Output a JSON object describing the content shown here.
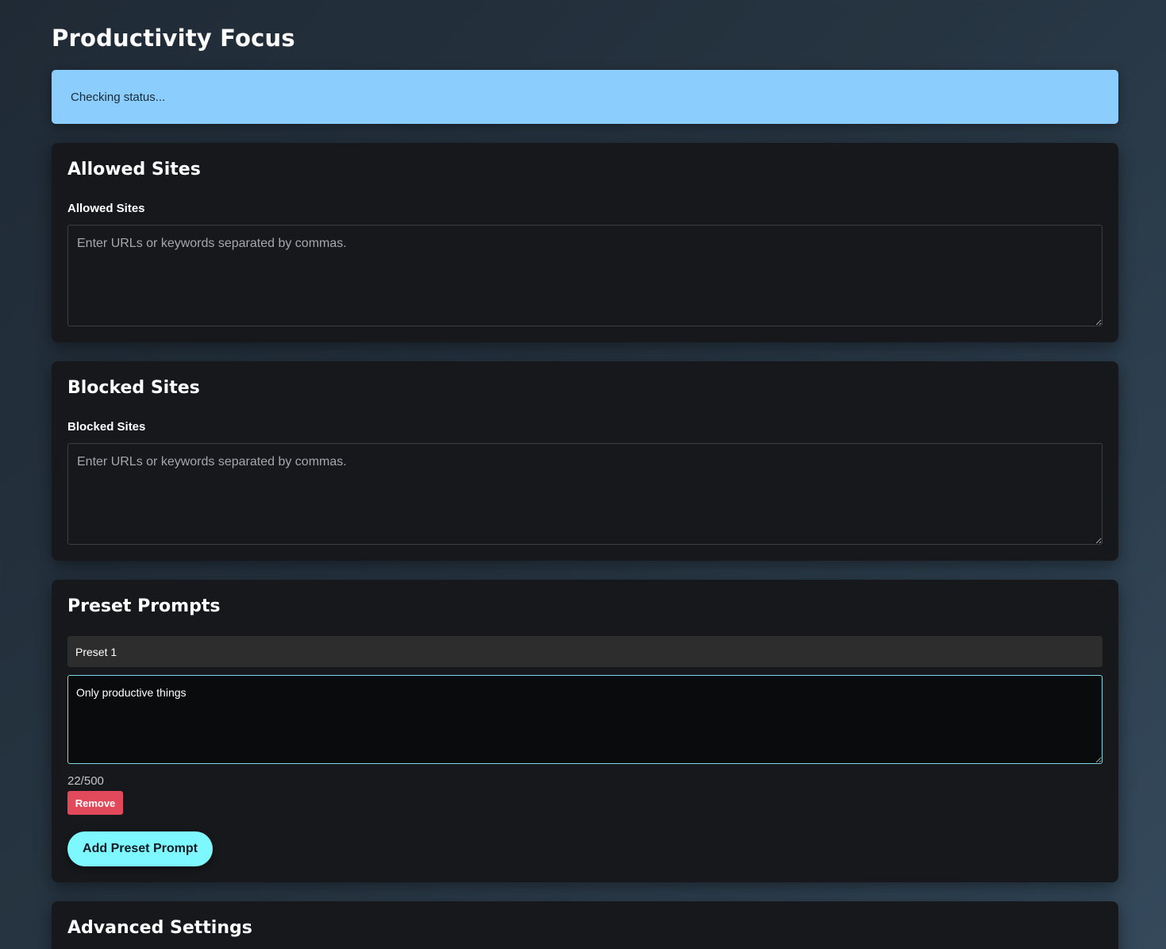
{
  "page": {
    "title": "Productivity Focus"
  },
  "status": {
    "text": "Checking status..."
  },
  "allowed": {
    "title": "Allowed Sites",
    "label": "Allowed Sites",
    "placeholder": "Enter URLs or keywords separated by commas.",
    "value": ""
  },
  "blocked": {
    "title": "Blocked Sites",
    "label": "Blocked Sites",
    "placeholder": "Enter URLs or keywords separated by commas.",
    "value": ""
  },
  "presets": {
    "title": "Preset Prompts",
    "items": [
      {
        "name": "Preset 1",
        "prompt": "Only productive things",
        "count": "22/500",
        "remove_label": "Remove"
      }
    ],
    "add_label": "Add Preset Prompt"
  },
  "advanced": {
    "title": "Advanced Settings"
  },
  "colors": {
    "status_bg": "#8bcdfc",
    "card_bg": "#16181c",
    "accent": "#7ef8ff",
    "danger": "#e2495a"
  }
}
